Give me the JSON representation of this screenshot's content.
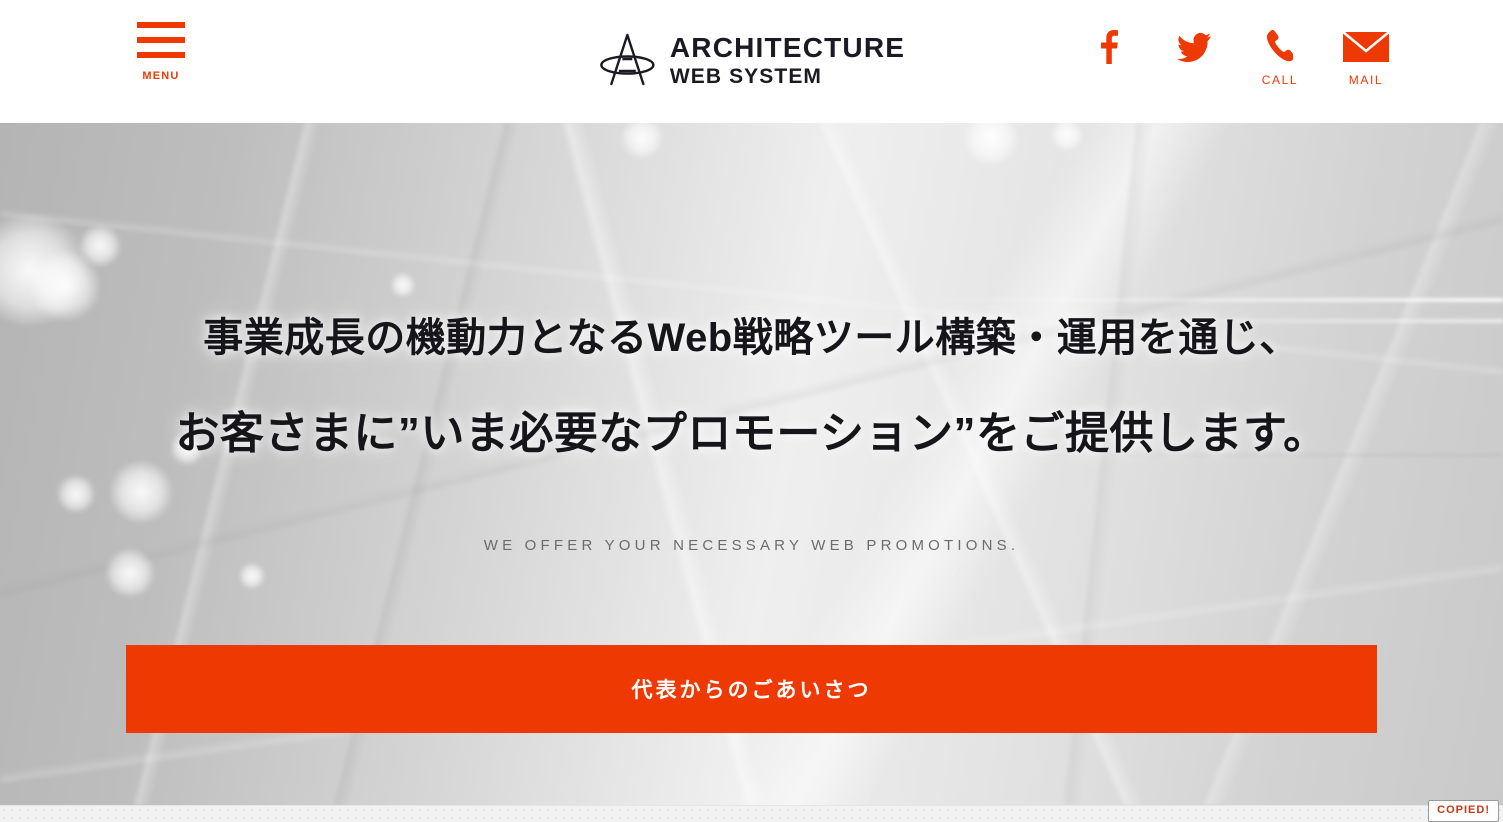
{
  "header": {
    "menu": {
      "label": "MENU",
      "icon": "hamburger-icon"
    },
    "logo": {
      "line1": "ARCHITECTURE",
      "line2": "WEB SYSTEM",
      "mark": "stylized-a-logo-icon"
    },
    "social": [
      {
        "icon": "facebook-icon",
        "label": ""
      },
      {
        "icon": "twitter-icon",
        "label": ""
      },
      {
        "icon": "phone-icon",
        "label": "CALL"
      },
      {
        "icon": "mail-icon",
        "label": "MAIL"
      }
    ]
  },
  "hero": {
    "headline_line1": "事業成長の機動力となるWeb戦略ツール構築・運用を通じ、",
    "headline_line2": "お客さまに”いま必要なプロモーション”をご提供します。",
    "subtitle_en": "WE OFFER YOUR NECESSARY WEB PROMOTIONS.",
    "cta_label": "代表からのごあいさつ"
  },
  "footer": {
    "copied_toast": "COPIED!"
  },
  "colors": {
    "accent": "#EF3903",
    "text_dark": "#15151a",
    "text_muted": "#6c6c70",
    "header_bg": "#ffffff"
  }
}
